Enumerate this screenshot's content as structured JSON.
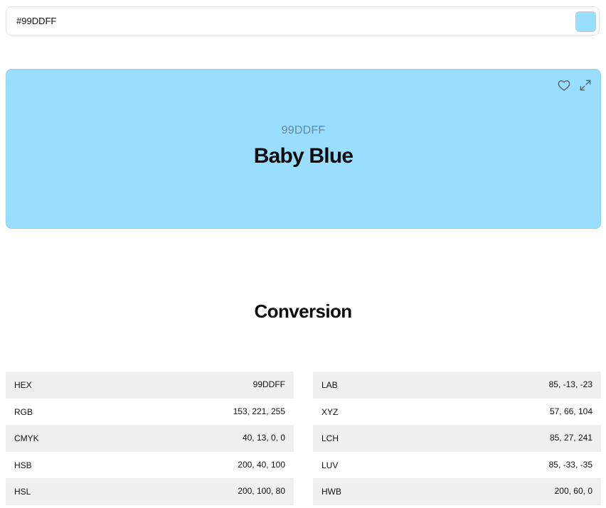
{
  "search": {
    "value": "#99DDFF"
  },
  "colors": {
    "current": "#99DDFF",
    "icon": "#555f66"
  },
  "preview": {
    "hex": "99DDFF",
    "name": "Baby Blue",
    "icons": [
      "heart-icon",
      "expand-icon"
    ]
  },
  "conversion": {
    "title": "Conversion",
    "left": [
      {
        "label": "HEX",
        "value": "99DDFF"
      },
      {
        "label": "RGB",
        "value": "153, 221, 255"
      },
      {
        "label": "CMYK",
        "value": "40, 13, 0, 0"
      },
      {
        "label": "HSB",
        "value": "200, 40, 100"
      },
      {
        "label": "HSL",
        "value": "200, 100, 80"
      }
    ],
    "right": [
      {
        "label": "LAB",
        "value": "85, -13, -23"
      },
      {
        "label": "XYZ",
        "value": "57, 66, 104"
      },
      {
        "label": "LCH",
        "value": "85, 27, 241"
      },
      {
        "label": "LUV",
        "value": "85, -33, -35"
      },
      {
        "label": "HWB",
        "value": "200, 60, 0"
      }
    ]
  }
}
